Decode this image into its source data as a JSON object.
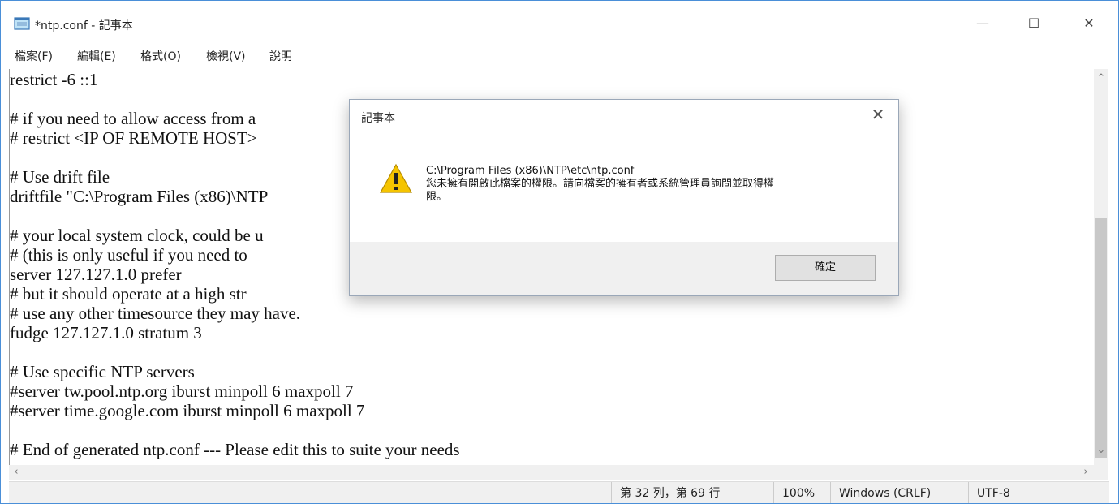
{
  "window": {
    "title": "*ntp.conf - 記事本",
    "controls": {
      "minimize": "—",
      "maximize": "☐",
      "close": "✕"
    }
  },
  "menu": [
    {
      "label": "檔案(F)"
    },
    {
      "label": "編輯(E)"
    },
    {
      "label": "格式(O)"
    },
    {
      "label": "檢視(V)"
    },
    {
      "label": "說明"
    }
  ],
  "editor": {
    "lines": [
      "restrict -6 ::1",
      "",
      "# if you need to allow access from a",
      "# restrict <IP OF REMOTE HOST>",
      "",
      "# Use drift file",
      "driftfile \"C:\\Program Files (x86)\\NTP",
      "",
      "# your local system clock, could be u",
      "# (this is only useful if you need to",
      "server 127.127.1.0 prefer",
      "# but it should operate at a high str",
      "# use any other timesource they may have.",
      "fudge 127.127.1.0 stratum 3",
      "",
      "# Use specific NTP servers",
      "#server tw.pool.ntp.org iburst minpoll 6 maxpoll 7",
      "#server time.google.com iburst minpoll 6 maxpoll 7",
      "",
      "# End of generated ntp.conf --- Please edit this to suite your needs"
    ]
  },
  "scrollbar": {
    "up": "⌃",
    "down": "⌄",
    "left": "‹",
    "right": "›"
  },
  "status": {
    "position": "第 32 列，第 69 行",
    "zoom": "100%",
    "line_ending": "Windows (CRLF)",
    "encoding": "UTF-8"
  },
  "dialog": {
    "title": "記事本",
    "close": "✕",
    "path": "C:\\Program Files (x86)\\NTP\\etc\\ntp.conf",
    "message_line1": "您未擁有開啟此檔案的權限。請向檔案的擁有者或系統管理員詢問並取得權",
    "message_line2": "限。",
    "ok_label": "確定",
    "icon": "warning-icon"
  },
  "colors": {
    "accent": "#4a8fd8",
    "warning": "#f5c400"
  }
}
